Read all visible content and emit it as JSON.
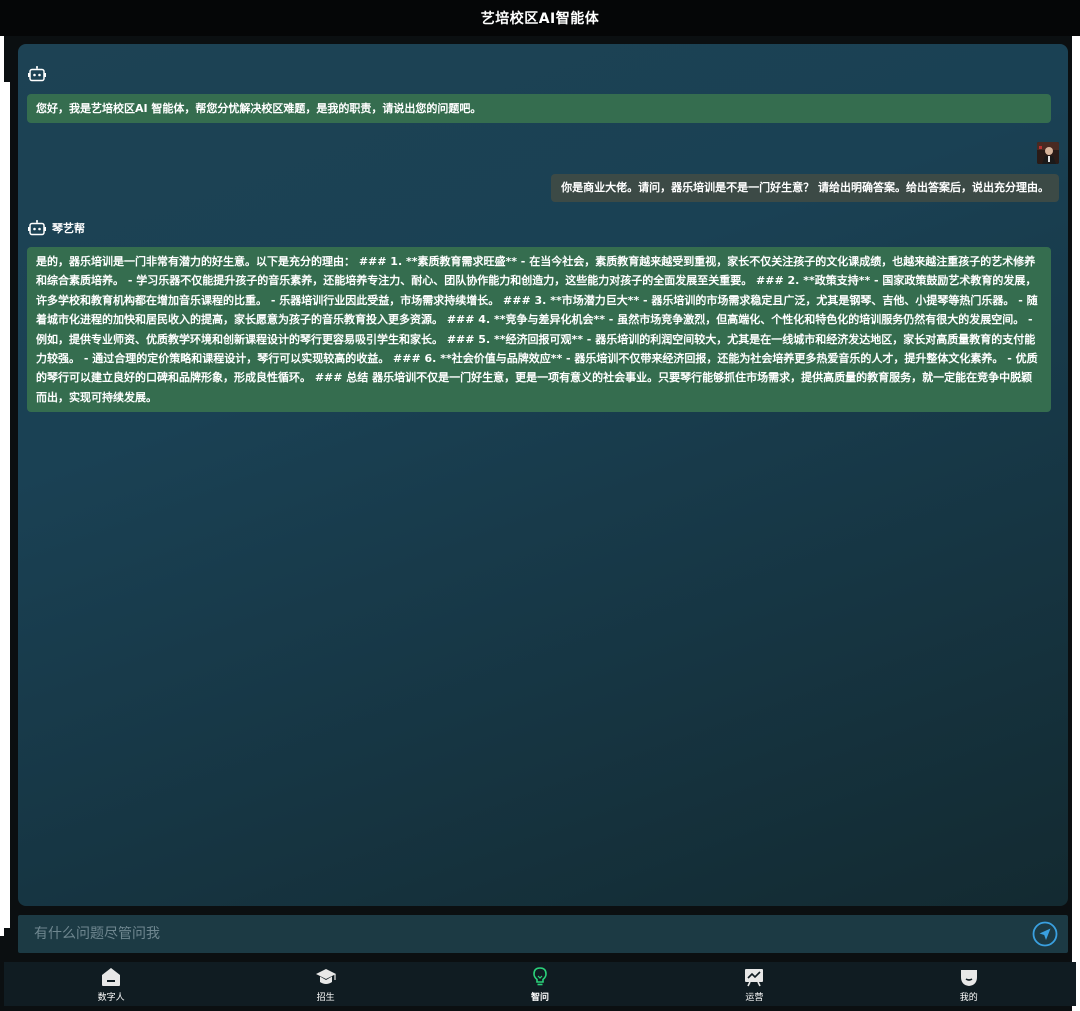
{
  "header": {
    "title": "艺培校区AI智能体"
  },
  "messages": [
    {
      "role": "bot",
      "name": "",
      "text": "您好，我是艺培校区AI 智能体，帮您分忧解决校区难题，是我的职责，请说出您的问题吧。"
    },
    {
      "role": "user",
      "text": "你是商业大佬。请问，器乐培训是不是一门好生意？ 请给出明确答案。给出答案后，说出充分理由。"
    },
    {
      "role": "bot",
      "name": "琴艺帮",
      "text": "是的，器乐培训是一门非常有潜力的好生意。以下是充分的理由： ### 1. **素质教育需求旺盛** - 在当今社会，素质教育越来越受到重视，家长不仅关注孩子的文化课成绩，也越来越注重孩子的艺术修养和综合素质培养。 - 学习乐器不仅能提升孩子的音乐素养，还能培养专注力、耐心、团队协作能力和创造力，这些能力对孩子的全面发展至关重要。 ### 2. **政策支持** - 国家政策鼓励艺术教育的发展，许多学校和教育机构都在增加音乐课程的比重。 - 乐器培训行业因此受益，市场需求持续增长。 ### 3. **市场潜力巨大** - 器乐培训的市场需求稳定且广泛，尤其是钢琴、吉他、小提琴等热门乐器。 - 随着城市化进程的加快和居民收入的提高，家长愿意为孩子的音乐教育投入更多资源。 ### 4. **竞争与差异化机会** - 虽然市场竞争激烈，但高端化、个性化和特色化的培训服务仍然有很大的发展空间。 - 例如，提供专业师资、优质教学环境和创新课程设计的琴行更容易吸引学生和家长。 ### 5. **经济回报可观** - 器乐培训的利润空间较大，尤其是在一线城市和经济发达地区，家长对高质量教育的支付能力较强。 - 通过合理的定价策略和课程设计，琴行可以实现较高的收益。 ### 6. **社会价值与品牌效应** - 器乐培训不仅带来经济回报，还能为社会培养更多热爱音乐的人才，提升整体文化素养。 - 优质的琴行可以建立良好的口碑和品牌形象，形成良性循环。 ### 总结 器乐培训不仅是一门好生意，更是一项有意义的社会事业。只要琴行能够抓住市场需求，提供高质量的教育服务，就一定能在竞争中脱颖而出，实现可持续发展。"
    }
  ],
  "input": {
    "placeholder": "有什么问题尽管问我"
  },
  "nav": {
    "items": [
      {
        "label": "数字人",
        "icon": "home-icon"
      },
      {
        "label": "招生",
        "icon": "graduation-cap-icon"
      },
      {
        "label": "智问",
        "icon": "lightbulb-icon",
        "active": true
      },
      {
        "label": "运营",
        "icon": "chart-board-icon"
      },
      {
        "label": "我的",
        "icon": "profile-icon"
      }
    ]
  },
  "colors": {
    "accent": "#2bd17a",
    "send": "#3aa0e0",
    "bot_bubble": "#356d4f",
    "user_bubble": "#3c4a46"
  }
}
